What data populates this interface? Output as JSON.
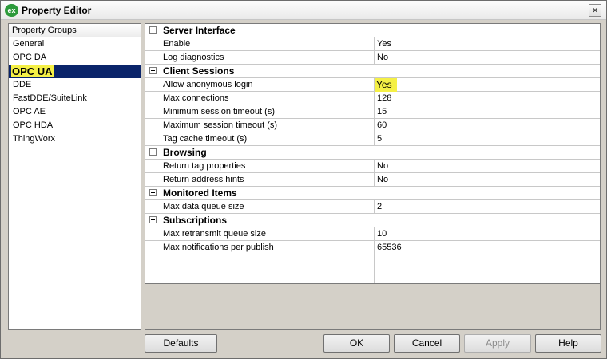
{
  "window": {
    "title": "Property Editor",
    "icon_text": "ex",
    "close_glyph": "×"
  },
  "groups": {
    "header": "Property Groups",
    "items": [
      "General",
      "OPC DA",
      "OPC UA",
      "DDE",
      "FastDDE/SuiteLink",
      "OPC AE",
      "OPC HDA",
      "ThingWorx"
    ],
    "selected": "OPC UA"
  },
  "categories": [
    {
      "label": "Server Interface",
      "props": [
        {
          "label": "Enable",
          "value": "Yes"
        },
        {
          "label": "Log diagnostics",
          "value": "No"
        }
      ]
    },
    {
      "label": "Client Sessions",
      "props": [
        {
          "label": "Allow anonymous login",
          "value": "Yes"
        },
        {
          "label": "Max connections",
          "value": "128"
        },
        {
          "label": "Minimum session timeout (s)",
          "value": "15"
        },
        {
          "label": "Maximum session timeout (s)",
          "value": "60"
        },
        {
          "label": "Tag cache timeout (s)",
          "value": "5"
        }
      ]
    },
    {
      "label": "Browsing",
      "props": [
        {
          "label": "Return tag properties",
          "value": "No"
        },
        {
          "label": "Return address hints",
          "value": "No"
        }
      ]
    },
    {
      "label": "Monitored Items",
      "props": [
        {
          "label": "Max data queue size",
          "value": "2"
        }
      ]
    },
    {
      "label": "Subscriptions",
      "props": [
        {
          "label": "Max retransmit queue size",
          "value": "10"
        },
        {
          "label": "Max notifications per publish",
          "value": "65536"
        }
      ]
    }
  ],
  "buttons": {
    "defaults": "Defaults",
    "ok": "OK",
    "cancel": "Cancel",
    "apply": "Apply",
    "help": "Help"
  },
  "colors": {
    "highlight": "#f5f046",
    "selection": "#0a246a"
  }
}
